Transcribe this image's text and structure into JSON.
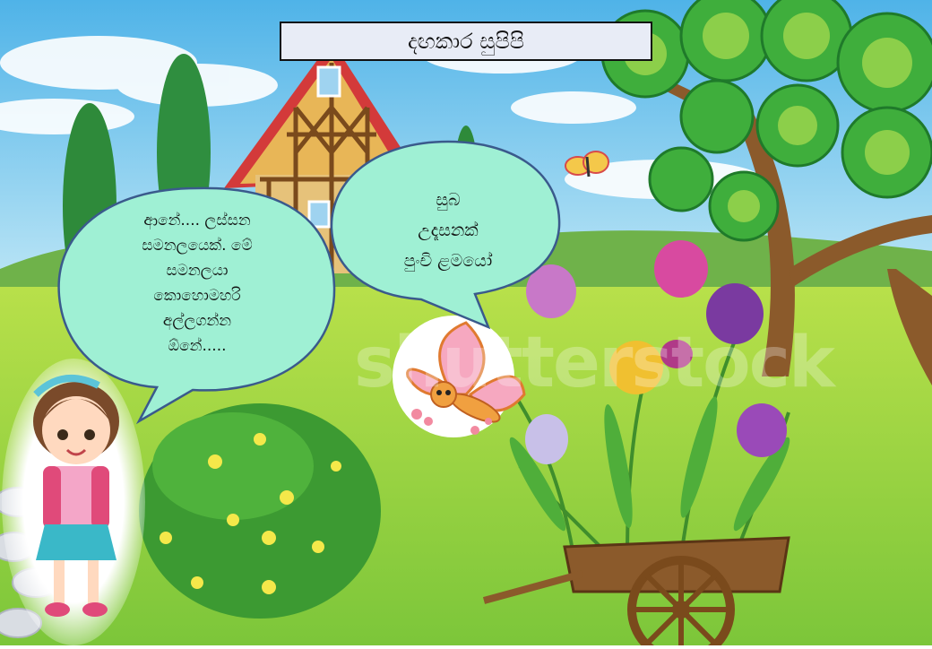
{
  "title": "දඟකාර සුපිපි",
  "girl_bubble": {
    "lines": [
      "ආනේ.... ලස්සන",
      "සමනලයෙක්. මේ",
      "සමනලයා",
      "කොහොමහරි",
      "අල්ලගන්න",
      "ඕනේ....."
    ]
  },
  "butterfly_bubble": {
    "lines": [
      "සුබ",
      "උදෑසනක්",
      "පුංචි ළමයෝ"
    ]
  },
  "watermark": "shutterstock",
  "colors": {
    "sky": "#7ec8ef",
    "grass": "#9ed94a",
    "bubble_fill": "#9ff0d4",
    "bubble_stroke": "#3a5a8c",
    "title_fill": "#e8ecf6"
  }
}
